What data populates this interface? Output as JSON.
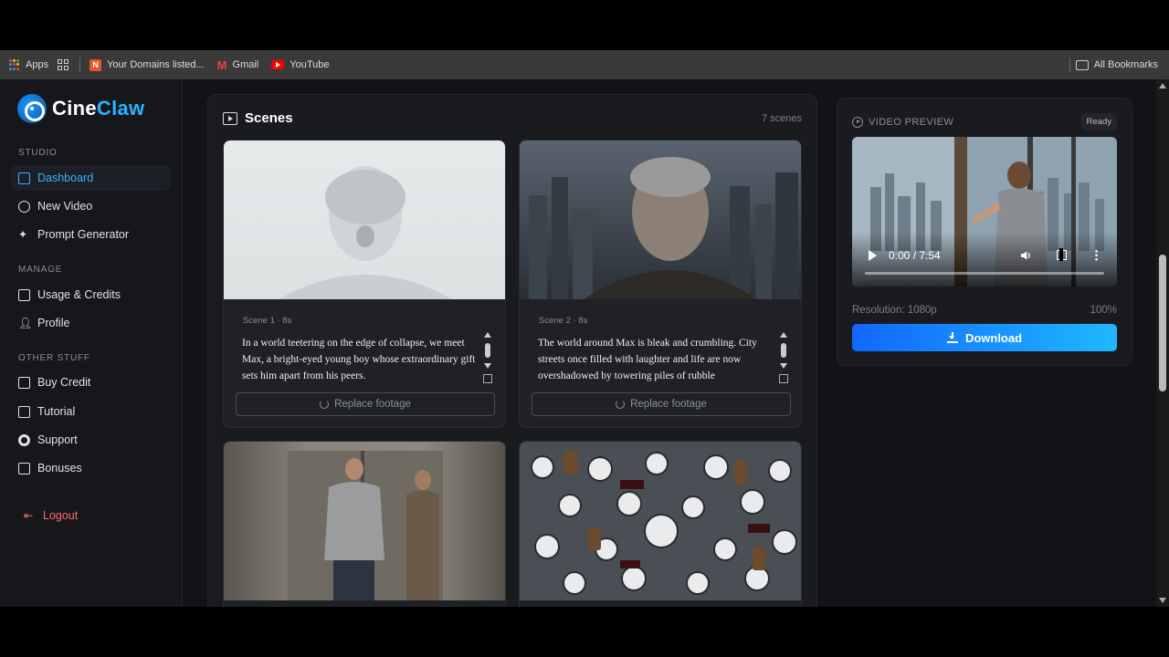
{
  "bookmarks": {
    "apps_label": "Apps",
    "items": [
      "Your Domains listed...",
      "Gmail",
      "YouTube"
    ],
    "all_bookmarks": "All Bookmarks"
  },
  "brand": {
    "name_part1": "Cine",
    "name_part2": "Claw",
    "accent": "#27b4ff"
  },
  "sidebar": {
    "studio_label": "STUDIO",
    "studio_items": [
      "Dashboard",
      "New Video",
      "Prompt Generator"
    ],
    "manage_label": "MANAGE",
    "manage_items": [
      "Usage & Credits",
      "Profile"
    ],
    "other_label": "OTHER STUFF",
    "other_items": [
      "Buy Credit",
      "Tutorial",
      "Support",
      "Bonuses"
    ],
    "logout": "Logout",
    "active_item": "Dashboard"
  },
  "scenes": {
    "title": "Scenes",
    "count": "7 scenes",
    "replace_label": "Replace footage",
    "cards": [
      {
        "meta": "Scene 1 · 8s",
        "text": "In a world teetering on the edge of collapse, we meet Max, a bright-eyed young boy whose extraordinary gift sets him apart from his peers."
      },
      {
        "meta": "Scene 2 · 8s",
        "text": "The world around Max is bleak and crumbling. City streets once filled with laughter and life are now overshadowed by towering piles of rubble"
      }
    ]
  },
  "preview": {
    "title": "VIDEO PREVIEW",
    "status": "Ready",
    "time": "0:00 / 7:54",
    "resolution": "Resolution: 1080p",
    "percent": "100%",
    "download": "Download"
  }
}
